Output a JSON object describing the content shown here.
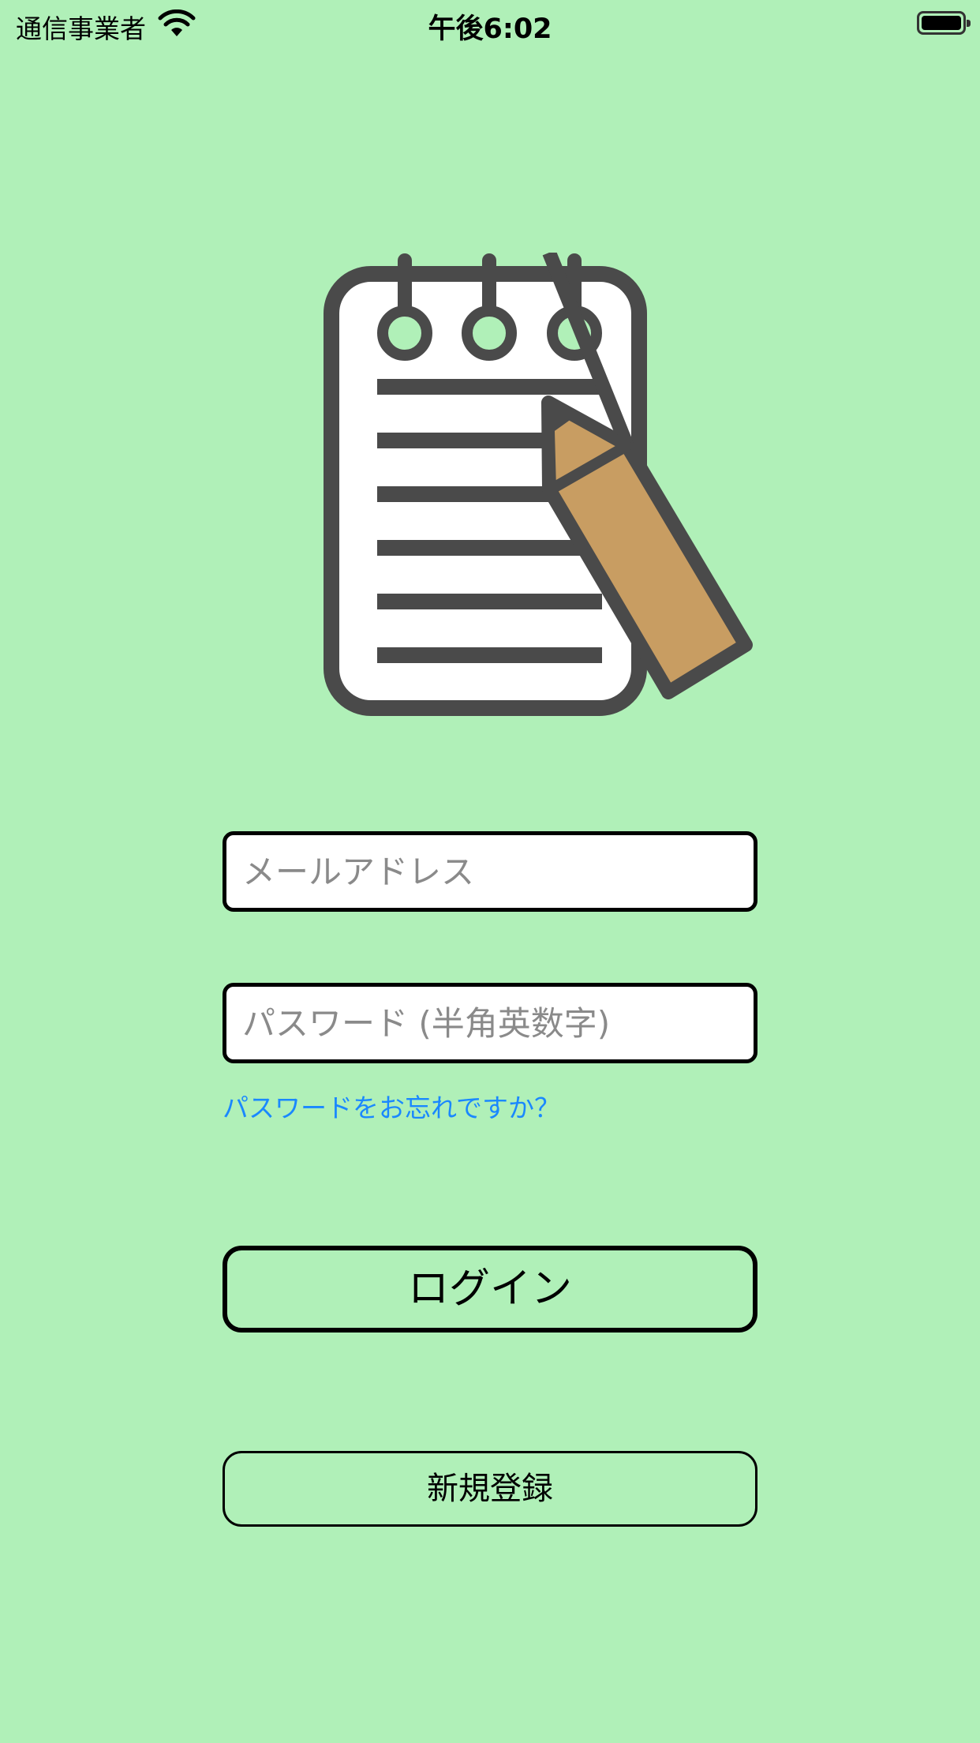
{
  "status_bar": {
    "carrier": "通信事業者",
    "time": "午後6:02"
  },
  "login_form": {
    "email_placeholder": "メールアドレス",
    "password_placeholder": "パスワード (半角英数字)",
    "forgot_link": "パスワードをお忘れですか？",
    "login_button": "ログイン",
    "signup_button": "新規登録"
  },
  "icons": {
    "logo": "notepad-pencil-icon",
    "wifi": "wifi-icon",
    "battery": "battery-icon"
  },
  "colors": {
    "background": "#b0f0b8",
    "link": "#1a88ff",
    "logo_outline": "#4a4a4a",
    "pencil": "#c89d62"
  }
}
